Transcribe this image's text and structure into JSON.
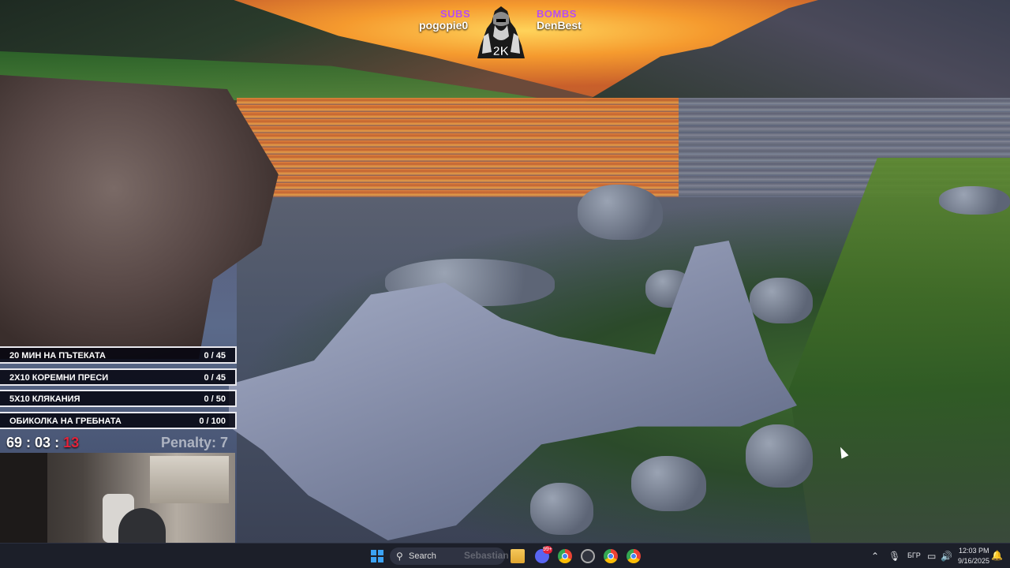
{
  "overlay": {
    "subs_label": "SUBS",
    "subs_name": "pogopie0",
    "bombs_label": "BOMBS",
    "bombs_name": "DenBest",
    "mascot_badge": "2K"
  },
  "challenges": [
    {
      "name": "20 МИН НА ПЪТЕКАТА",
      "count": "0 / 45"
    },
    {
      "name": "2Х10 КОРЕМНИ ПРЕСИ",
      "count": "0 / 45"
    },
    {
      "name": "5Х10 КЛЯКАНИЯ",
      "count": "0 / 50"
    },
    {
      "name": "ОБИКОЛКА НА ГРЕБНАТА",
      "count": "0 / 100"
    }
  ],
  "timer": {
    "hours": "69",
    "minutes": "03",
    "seconds": "13",
    "separator": " : "
  },
  "penalty_text": "Penalty: 7",
  "taskbar": {
    "search_placeholder": "Search",
    "search_ghost": "Sebastian",
    "discord_badge": "99+",
    "language": "БГР",
    "time": "12:03 PM",
    "date": "9/16/2025",
    "icons": [
      "windows-start",
      "search",
      "file-explorer",
      "discord",
      "chrome",
      "obs",
      "chrome",
      "chrome"
    ],
    "tray_icons": [
      "chevron-up",
      "microphone",
      "speaker",
      "monitor",
      "battery",
      "bell"
    ]
  },
  "colors": {
    "accent_purple": "#b64df2",
    "timer_red": "#e2233a",
    "taskbar_bg": "#1c1f29"
  }
}
